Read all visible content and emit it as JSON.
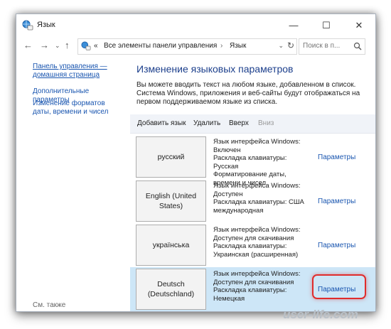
{
  "window": {
    "title": "Язык",
    "min_glyph": "—",
    "max_glyph": "☐",
    "close_glyph": "✕"
  },
  "nav": {
    "back": "←",
    "forward": "→",
    "recent": "⌄",
    "up": "↑"
  },
  "address": {
    "overflow": "«",
    "crumbs": [
      "Все элементы панели управления",
      "Язык"
    ],
    "separator": "›",
    "dropdown": "⌄",
    "refresh": "↻"
  },
  "search": {
    "placeholder": "Поиск в п..."
  },
  "sidebar": {
    "home_link": "Панель управления — домашняя страница",
    "advanced_link": "Дополнительные параметры",
    "formats_link": "Изменение форматов даты, времени и чисел",
    "see_also": "См. также"
  },
  "main": {
    "title": "Изменение языковых параметров",
    "description": "Вы можете вводить текст на любом языке, добавленном в список. Система Windows, приложения и веб-сайты будут отображаться на первом поддерживаемом языке из списка."
  },
  "toolbar": {
    "add": "Добавить язык",
    "remove": "Удалить",
    "up": "Вверх",
    "down": "Вниз"
  },
  "languages": [
    {
      "name": "русский",
      "info": [
        "Язык интерфейса Windows:",
        "Включен",
        "Раскладка клавиатуры: Русская",
        "Форматирование даты, времени и чисел"
      ],
      "options": "Параметры"
    },
    {
      "name": "English (United States)",
      "info": [
        "Язык интерфейса Windows:",
        "Доступен",
        "Раскладка клавиатуры: США",
        "международная"
      ],
      "options": "Параметры"
    },
    {
      "name": "українська",
      "info": [
        "Язык интерфейса Windows:",
        "Доступен для скачивания",
        "Раскладка клавиатуры:",
        "Украинская (расширенная)"
      ],
      "options": "Параметры"
    },
    {
      "name": "Deutsch (Deutschland)",
      "info": [
        "Язык интерфейса Windows:",
        "Доступен для скачивания",
        "Раскладка клавиатуры:",
        "Немецкая"
      ],
      "options": "Параметры"
    }
  ],
  "watermark": "user-life.com",
  "colors": {
    "link": "#1a56b0",
    "title": "#1c3f8c",
    "selected_row": "#cde6f7",
    "highlight": "#e02c2c"
  }
}
